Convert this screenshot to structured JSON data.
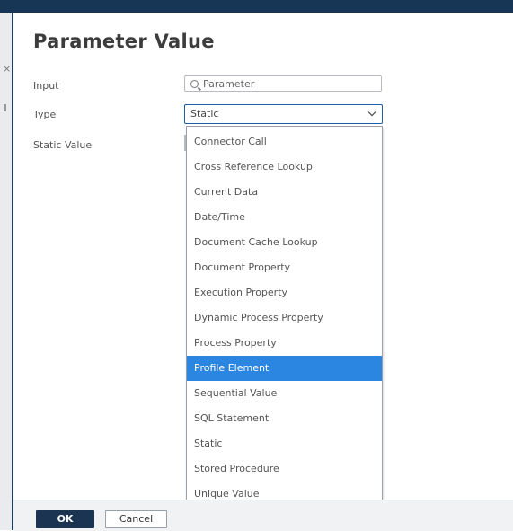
{
  "dialog": {
    "title": "Parameter Value"
  },
  "form": {
    "input_label": "Input",
    "input_value": "Parameter",
    "type_label": "Type",
    "type_value": "Static",
    "static_value_label": "Static Value"
  },
  "dropdown": {
    "options": [
      "Connector Call",
      "Cross Reference Lookup",
      "Current Data",
      "Date/Time",
      "Document Cache Lookup",
      "Document Property",
      "Execution Property",
      "Dynamic Process Property",
      "Process Property",
      "Profile Element",
      "Sequential Value",
      "SQL Statement",
      "Static",
      "Stored Procedure",
      "Unique Value"
    ],
    "highlighted_option": "Profile Element"
  },
  "footer": {
    "ok_label": "OK",
    "cancel_label": "Cancel"
  },
  "colors": {
    "header_bar": "#173656",
    "highlight": "#2a86e0",
    "ok_button": "#1b3452",
    "select_focus_border": "#1b5fa5"
  },
  "icons": {
    "input_field": "search-icon",
    "type_select": "chevron-down-icon"
  }
}
